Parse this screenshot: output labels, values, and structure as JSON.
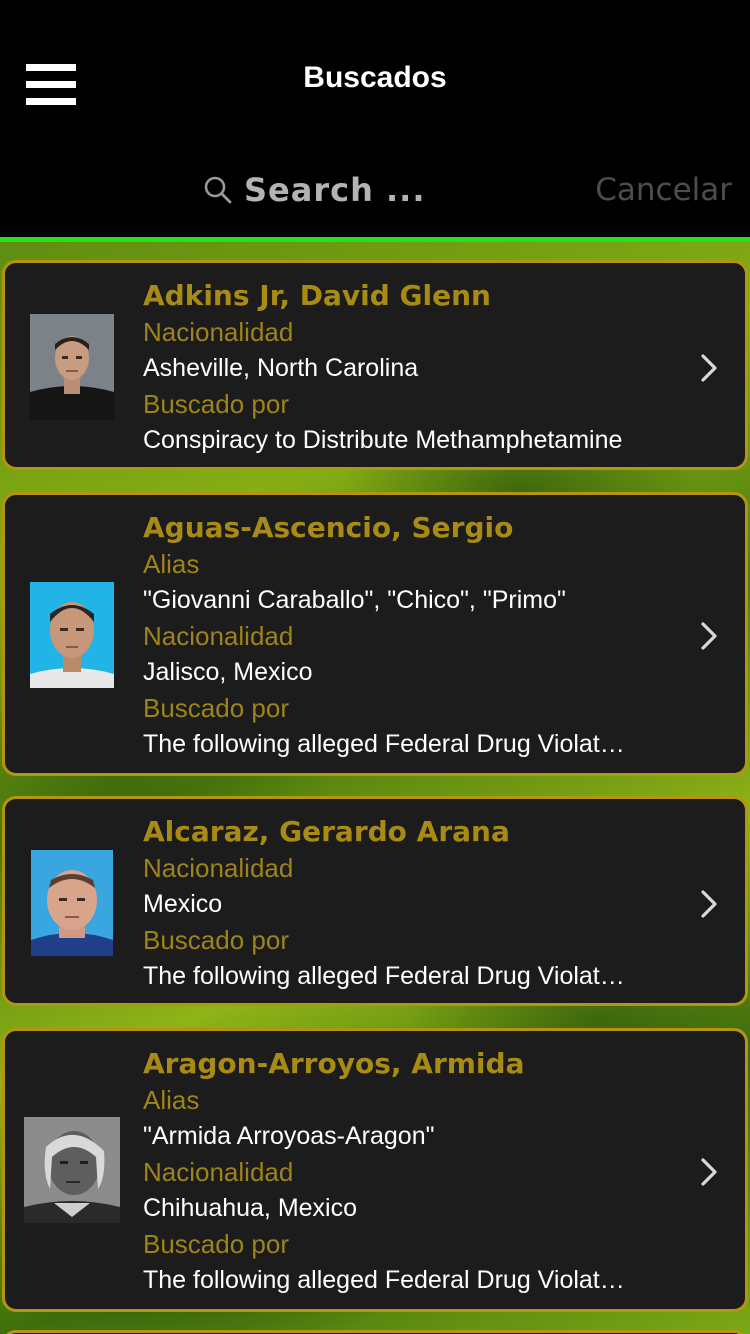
{
  "header": {
    "title": "Buscados",
    "menu_icon": "hamburger-icon"
  },
  "search": {
    "placeholder": "Search ...",
    "value": "",
    "cancel_label": "Cancelar",
    "icon": "search-icon"
  },
  "colors": {
    "accent_gold": "#b39513",
    "label_gold": "#9d8419",
    "divider_green": "#23e11f",
    "card_bg": "#1c1c1c"
  },
  "list": [
    {
      "name": "Adkins Jr, David Glenn",
      "nationality_label": "Nacionalidad",
      "nationality": "Asheville, North Carolina",
      "wanted_label": "Buscado por",
      "wanted_for": "Conspiracy to Distribute Methamphetamine"
    },
    {
      "name": "Aguas-Ascencio, Sergio",
      "alias_label": "Alias",
      "alias": "\"Giovanni Caraballo\", \"Chico\", \"Primo\"",
      "nationality_label": "Nacionalidad",
      "nationality": "Jalisco, Mexico",
      "wanted_label": "Buscado por",
      "wanted_for": "The following alleged Federal Drug Violat…"
    },
    {
      "name": "Alcaraz, Gerardo Arana",
      "nationality_label": "Nacionalidad",
      "nationality": "Mexico",
      "wanted_label": "Buscado por",
      "wanted_for": "The following alleged Federal Drug Violat…"
    },
    {
      "name": "Aragon-Arroyos, Armida",
      "alias_label": "Alias",
      "alias": "\"Armida Arroyoas-Aragon\"",
      "nationality_label": "Nacionalidad",
      "nationality": "Chihuahua, Mexico",
      "wanted_label": "Buscado por",
      "wanted_for": "The following alleged Federal Drug Violat…"
    }
  ]
}
